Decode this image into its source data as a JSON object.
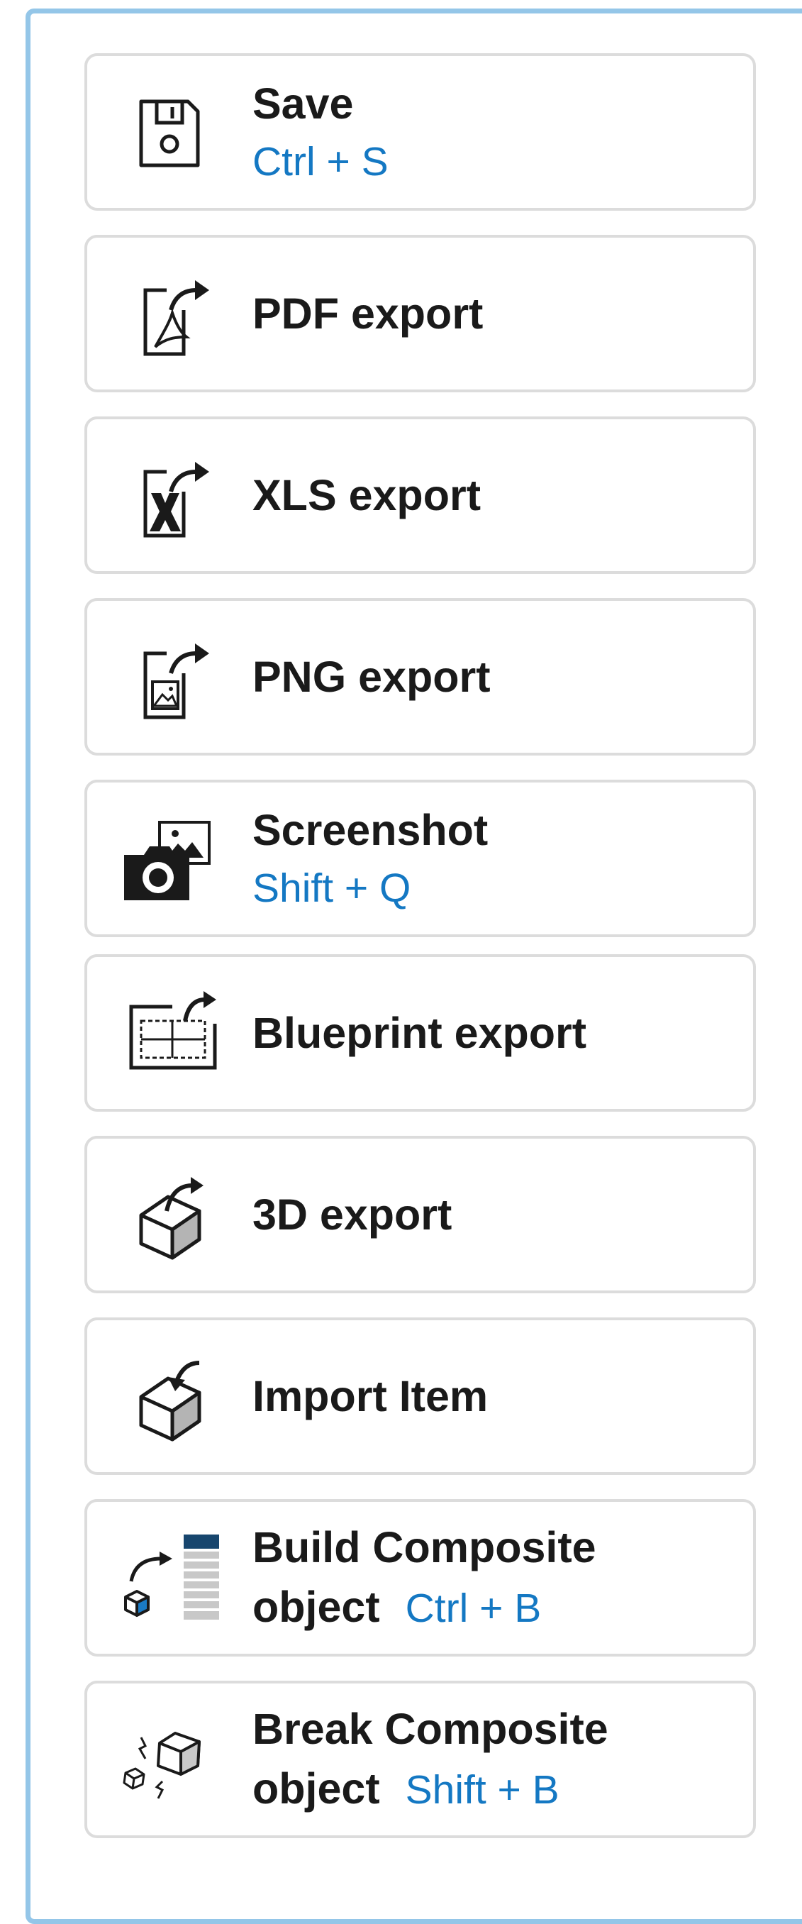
{
  "items": [
    {
      "id": "save",
      "title": "Save",
      "shortcut": "Ctrl + S",
      "icon": "floppy-disk-icon"
    },
    {
      "id": "pdf",
      "title": "PDF export",
      "icon": "pdf-export-icon"
    },
    {
      "id": "xls",
      "title": "XLS export",
      "icon": "xls-export-icon"
    },
    {
      "id": "png",
      "title": "PNG export",
      "icon": "png-export-icon"
    },
    {
      "id": "screenshot",
      "title": "Screenshot",
      "shortcut": "Shift + Q",
      "icon": "camera-icon"
    },
    {
      "id": "blueprint",
      "title": "Blueprint export",
      "icon": "blueprint-export-icon"
    },
    {
      "id": "export3d",
      "title": "3D export",
      "icon": "cube-export-icon"
    },
    {
      "id": "import",
      "title": "Import Item",
      "icon": "cube-import-icon"
    },
    {
      "id": "build",
      "title_line1": "Build Composite",
      "title_line2": "object",
      "shortcut": "Ctrl + B",
      "icon": "build-composite-icon"
    },
    {
      "id": "break",
      "title_line1": "Break Composite",
      "title_line2": "object",
      "shortcut": "Shift + B",
      "icon": "break-composite-icon"
    }
  ],
  "colors": {
    "accent": "#1478c3",
    "panel_border": "#94c6e8",
    "item_border": "#dcdcdc",
    "text": "#1a1a1a"
  }
}
